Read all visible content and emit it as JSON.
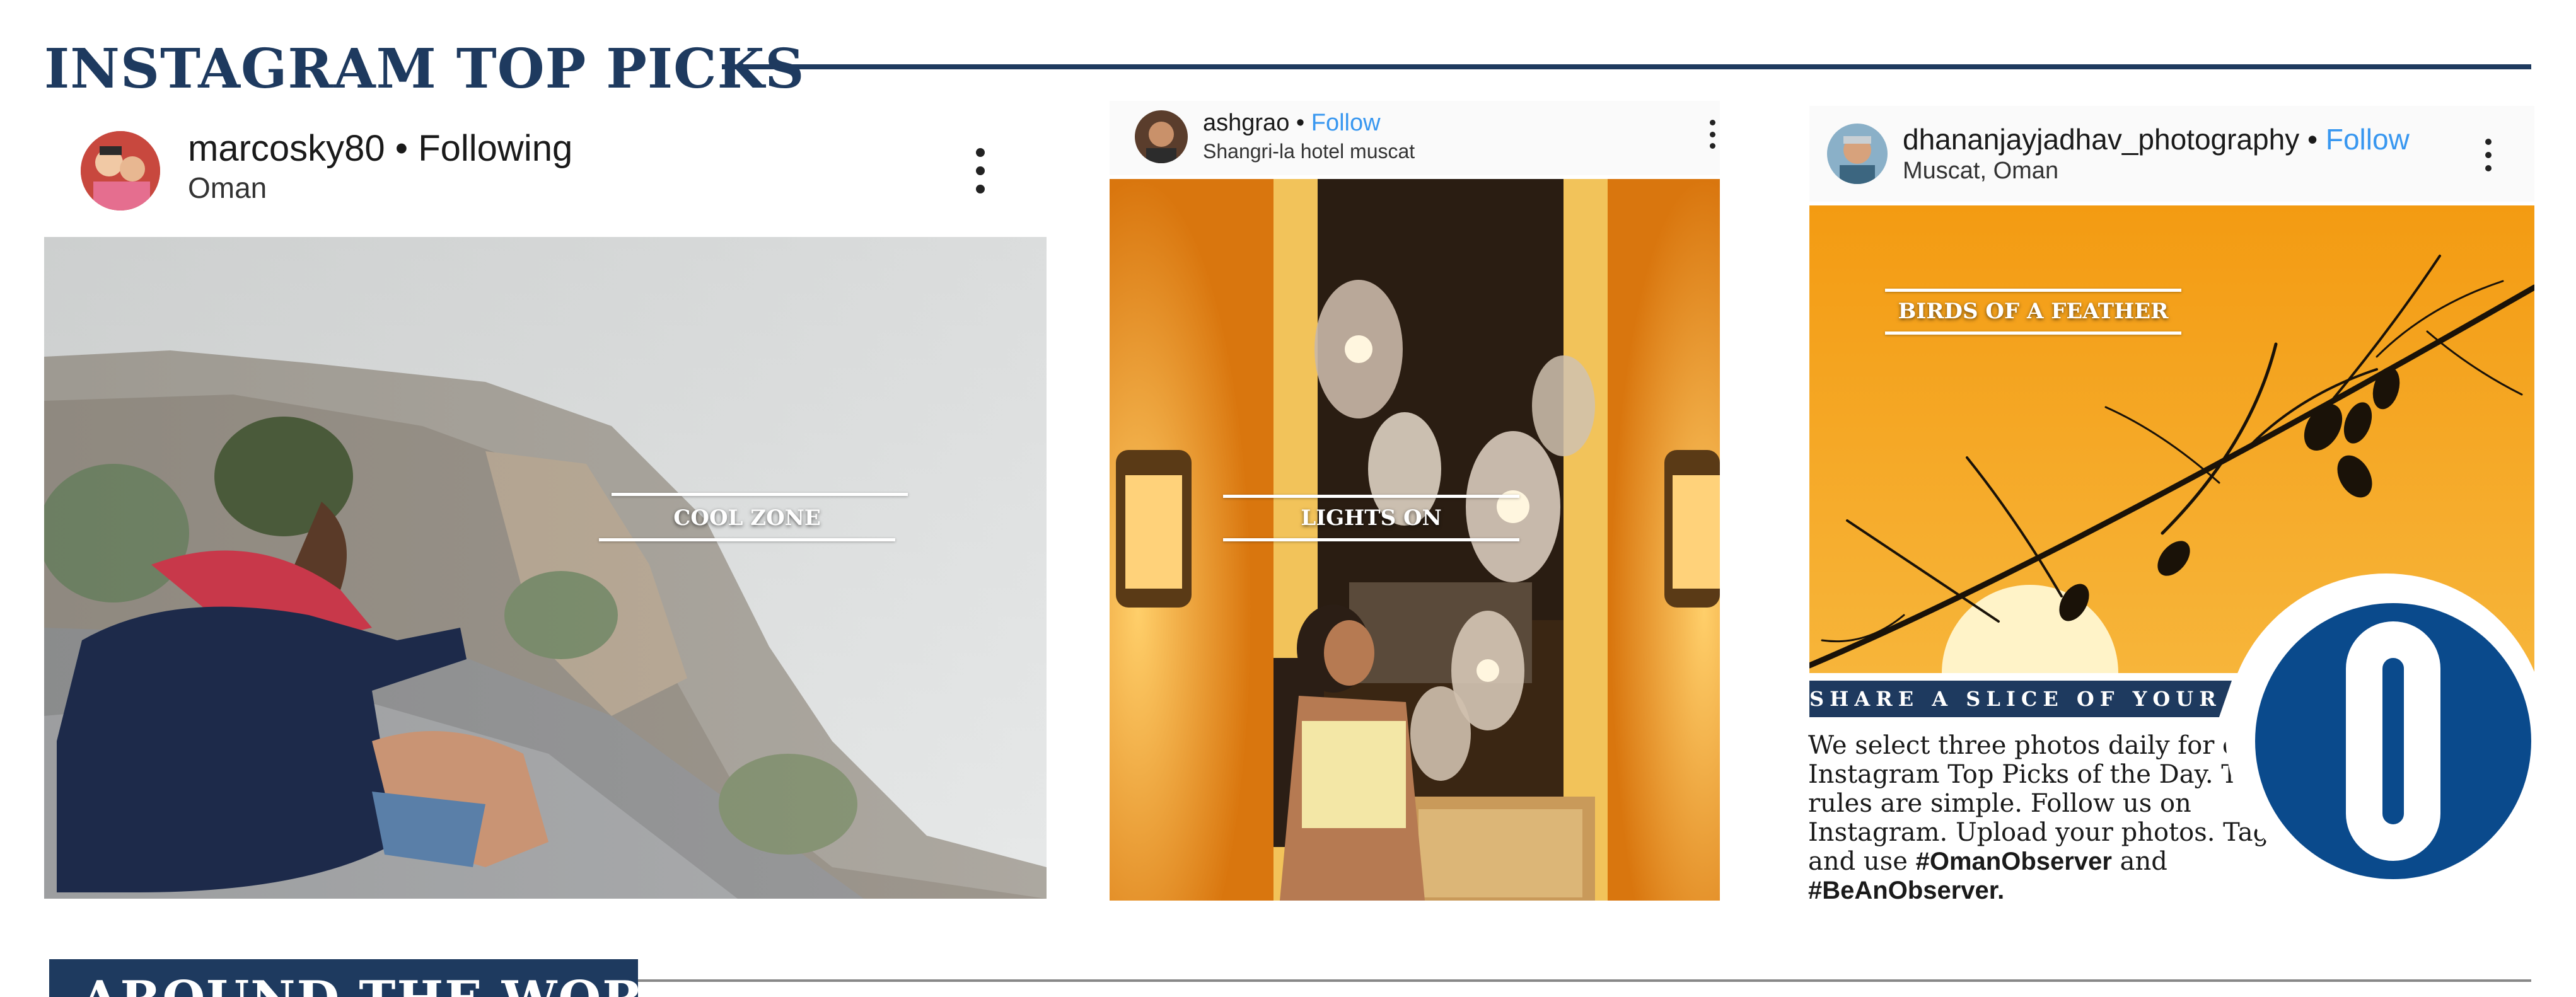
{
  "section": {
    "title": "INSTAGRAM TOP PICKS"
  },
  "posts": [
    {
      "username": "marcosky80",
      "separator": "•",
      "status": "Following",
      "location": "Oman",
      "caption": "COOL ZONE",
      "menu_icon": "kebab-menu-icon"
    },
    {
      "username": "ashgrao",
      "separator": "•",
      "status": "Follow",
      "location": "Shangri-la hotel muscat",
      "caption": "LIGHTS ON",
      "menu_icon": "kebab-menu-icon"
    },
    {
      "username": "dhananjayjadhav_photography",
      "separator": "•",
      "status": "Follow",
      "location": "Muscat, Oman",
      "caption": "BIRDS OF A FEATHER",
      "menu_icon": "kebab-menu-icon"
    }
  ],
  "promo": {
    "banner": "SHARE A SLICE OF YOUR LIFE",
    "body": "We select three photos daily for our Instagram Top Picks of the Day. The rules are simple. Follow us on Instagram. Upload your photos. Tag us and use",
    "tag1": "#OmanObserver",
    "joiner": "and",
    "tag2": "#BeAnObserver.",
    "logo_letter": "O"
  },
  "next_section": {
    "title": "AROUND THE WORLD"
  },
  "colors": {
    "navy": "#1e3a5f",
    "follow_blue": "#3897f0",
    "logo_blue": "#0a4a8c",
    "sunset_orange": "#f5a21b"
  }
}
